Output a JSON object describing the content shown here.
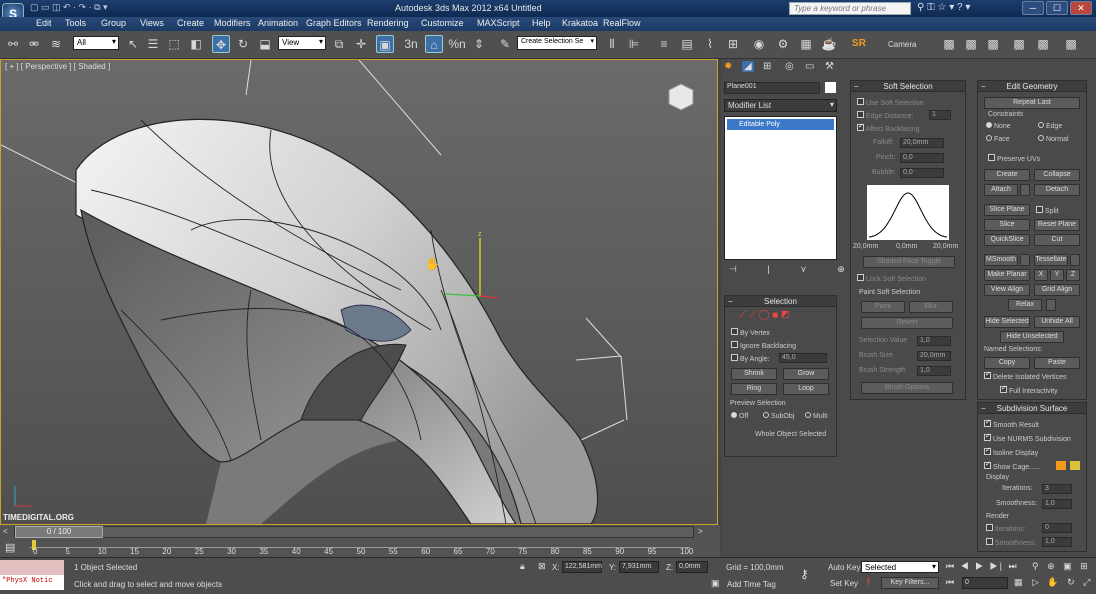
{
  "window": {
    "title": "Autodesk 3ds Max  2012 x64        Untitled",
    "search_placeholder": "Type a keyword or phrase",
    "controls": [
      "─",
      "☐",
      "✕"
    ]
  },
  "menubar": {
    "logo": "S",
    "items": [
      "Edit",
      "Tools",
      "Group",
      "Views",
      "Create",
      "Modifiers",
      "Animation",
      "Graph Editors",
      "Rendering",
      "Customize",
      "MAXScript",
      "Help",
      "Krakatoa",
      "RealFlow"
    ]
  },
  "toolbar": {
    "filter_value": "All",
    "ref_coord_value": "View",
    "selection_set_value": "Create Selection Se",
    "sr_label": "SR",
    "camera_label": "Camera",
    "snap_label": "3n",
    "angle_label": "⌂",
    "percent_label": "%n"
  },
  "viewport": {
    "label": "[ + ] [ Perspective ] [ Shaded ]",
    "watermark": "TIMEDIGITAL.ORG",
    "gizmo_z": "z"
  },
  "command_panel": {
    "object_name": "Plane001",
    "modifier_list": "Modifier List",
    "stack_item": "Editable Poly",
    "selection": {
      "title": "Selection",
      "by_vertex": "By Vertex",
      "ignore_backfacing": "Ignore Backfacing",
      "by_angle": "By Angle:",
      "by_angle_value": "45,0",
      "shrink": "Shrink",
      "grow": "Grow",
      "ring": "Ring",
      "loop": "Loop",
      "preview_title": "Preview Selection",
      "preview_off": "Off",
      "preview_subobj": "SubObj",
      "preview_multi": "Multi",
      "status": "Whole Object Selected"
    },
    "soft_selection": {
      "title": "Soft Selection",
      "use_soft": "Use Soft Selection",
      "edge_distance": "Edge Distance:",
      "edge_distance_value": "1",
      "affect_backfacing": "Affect Backfacing",
      "falloff": "Falloff:",
      "falloff_value": "20,0mm",
      "pinch": "Pinch:",
      "pinch_value": "0,0",
      "bubble": "Bubble:",
      "bubble_value": "0,0",
      "curve_left": "20,0mm",
      "curve_mid": "0,0mm",
      "curve_right": "20,0mm",
      "shaded_face_toggle": "Shaded Face Toggle",
      "lock_soft": "Lock Soft Selection",
      "paint_title": "Paint Soft Selection",
      "paint": "Paint",
      "blur": "Blur",
      "revert": "Revert",
      "selection_value": "Selection Value",
      "selection_value_num": "1,0",
      "brush_size": "Brush Size",
      "brush_size_value": "20,0mm",
      "brush_strength": "Brush Strength",
      "brush_strength_value": "1,0",
      "brush_options": "Brush Options"
    },
    "edit_geometry": {
      "title": "Edit Geometry",
      "repeat_last": "Repeat Last",
      "constraints": "Constraints",
      "none": "None",
      "edge": "Edge",
      "face": "Face",
      "normal": "Normal",
      "preserve_uvs": "Preserve UVs",
      "create": "Create",
      "collapse": "Collapse",
      "attach": "Attach",
      "detach": "Detach",
      "slice_plane": "Slice Plane",
      "split": "Split",
      "slice": "Slice",
      "reset_plane": "Reset Plane",
      "quickslice": "QuickSlice",
      "cut": "Cut",
      "msmooth": "MSmooth",
      "tessellate": "Tessellate",
      "make_planar": "Make Planar",
      "x": "X",
      "y": "Y",
      "z": "Z",
      "view_align": "View Align",
      "grid_align": "Grid Align",
      "relax": "Relax",
      "hide_selected": "Hide Selected",
      "unhide_all": "Unhide All",
      "hide_unselected": "Hide Unselected",
      "named_selections": "Named Selections:",
      "copy": "Copy",
      "paste": "Paste",
      "delete_isolated": "Delete Isolated Vertices",
      "full_interactivity": "Full Interactivity"
    },
    "subdivision_surface": {
      "title": "Subdivision Surface",
      "smooth_result": "Smooth Result",
      "use_nurms": "Use NURMS Subdivision",
      "isoline_display": "Isoline Display",
      "show_cage": "Show Cage......",
      "display": "Display",
      "iterations": "Iterations:",
      "iterations_value": "3",
      "smoothness": "Smoothness:",
      "smoothness_value": "1,0",
      "render": "Render",
      "render_iterations": "Iterations:",
      "render_iterations_value": "0",
      "render_smoothness": "Smoothness:",
      "render_smoothness_value": "1,0",
      "cage_color_1": "#f39a1a",
      "cage_color_2": "#d9c23a"
    }
  },
  "timeline": {
    "slider_label": "0 / 100",
    "ticks": [
      "0",
      "5",
      "10",
      "15",
      "20",
      "25",
      "30",
      "35",
      "40",
      "45",
      "50",
      "55",
      "60",
      "65",
      "70",
      "75",
      "80",
      "85",
      "90",
      "95",
      "100"
    ]
  },
  "statusbar": {
    "maxscript_text": "\"PhysX Notic",
    "objects_selected": "1 Object Selected",
    "prompt": "Click and drag to select and move objects",
    "x_label": "X:",
    "x_value": "122,581mm",
    "y_label": "Y:",
    "y_value": "7,931mm",
    "z_label": "Z:",
    "z_value": "0,0mm",
    "grid": "Grid = 100,0mm",
    "add_time_tag": "Add Time Tag",
    "auto_key": "Auto Key",
    "set_key": "Set Key",
    "key_mode": "Selected",
    "key_filters": "Key Filters...",
    "frame": "0"
  }
}
